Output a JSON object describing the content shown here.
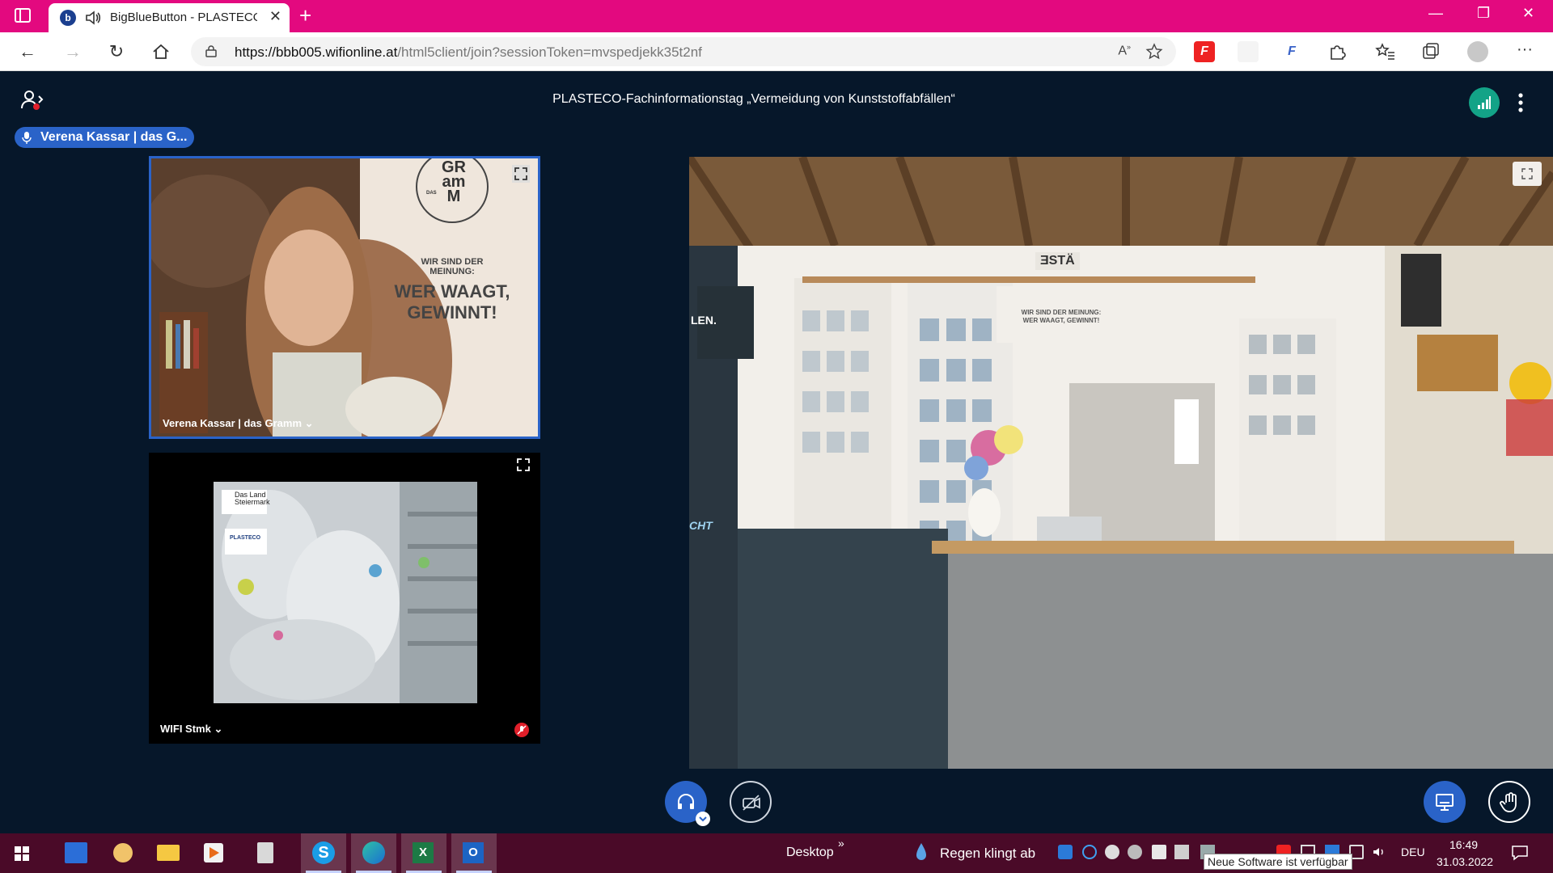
{
  "browser": {
    "tab_title": "BigBlueButton - PLASTECO-",
    "url_host": "https://bbb005.wifionline.at",
    "url_path": "/html5client/join?sessionToken=mvspedjekk35t2nf",
    "icons": [
      "sidebar-icon",
      "speaker-icon",
      "close-icon",
      "new-tab-icon",
      "back-icon",
      "forward-icon",
      "refresh-icon",
      "home-icon",
      "lock-icon",
      "read-aloud-icon",
      "add-favorite-icon",
      "extensions-icon",
      "favorites-icon",
      "collections-icon",
      "profile-icon",
      "more-icon"
    ],
    "accent": "#e3097f"
  },
  "bbb": {
    "meeting_title": "PLASTECO-Fachinformationstag „Vermeidung von Kunststoffabfällen“",
    "talking_indicator": "Verena Kassar | das G...",
    "videos": [
      {
        "name": "Verena Kassar | das Gramm ⌄",
        "poster_line1": "WIR SIND DER",
        "poster_line2": "MEINUNG:",
        "poster_big1": "WER WAAGT,",
        "poster_big2": "GEWINNT!",
        "logo_a": "GR",
        "logo_b": "am",
        "logo_c": "M",
        "logo_small": "DAS"
      },
      {
        "name": "WIFI Stmk ⌄",
        "slide_logo1": "Das Land",
        "slide_logo2": "Steiermark",
        "slide_logo3": "PLASTECO"
      }
    ],
    "screen_sign": "WIR SIND DER MEINUNG:",
    "screen_sign2": "WER WAAGT, GEWINNT!",
    "screen_left_text": "LEN.",
    "screen_cht_text": "CHT",
    "screen_banner": "ƎSTÄ",
    "primary": "#2a63c8"
  },
  "taskbar": {
    "desktop_label": "Desktop",
    "chevron": "»",
    "weather": "Regen klingt ab",
    "lang": "DEU",
    "time": "16:49",
    "date": "31.03.2022",
    "tooltip": "Neue Software ist verfügbar"
  }
}
